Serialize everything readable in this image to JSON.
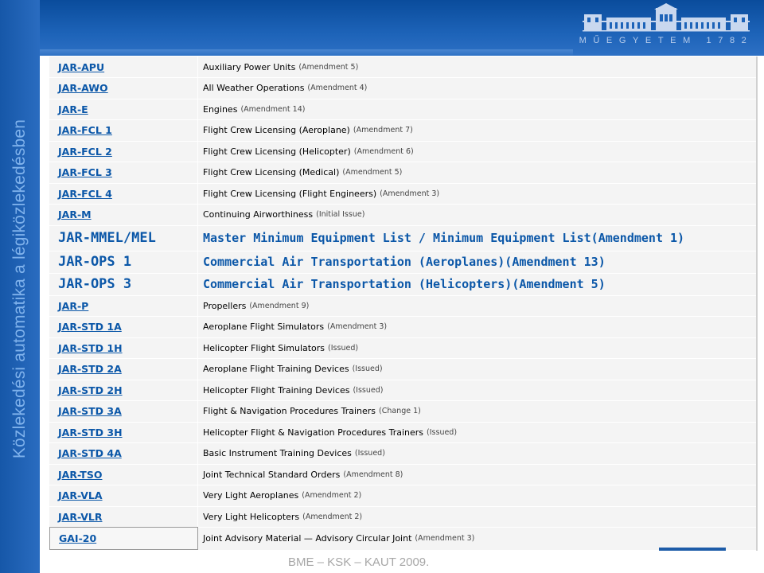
{
  "sidebar_title": "Közlekedési automatika a légiközlekedésben",
  "logo": {
    "text": "MŰEGYETEM 1782"
  },
  "footer": "BME – KSK – KAUT 2009.",
  "colors": {
    "header_blue": "#1d63b8",
    "link_blue": "#0b57a8",
    "table_bg": "#f4f4f4"
  },
  "rows": [
    {
      "code": "JAR-APU",
      "title": "Auxiliary Power Units",
      "amend": "(Amendment 5)",
      "style": "small"
    },
    {
      "code": "JAR-AWO",
      "title": "All Weather Operations",
      "amend": "(Amendment 4)",
      "style": "small"
    },
    {
      "code": "JAR-E",
      "title": "Engines",
      "amend": "(Amendment 14)",
      "style": "small"
    },
    {
      "code": "JAR-FCL 1",
      "title": "Flight Crew Licensing (Aeroplane)",
      "amend": "(Amendment 7)",
      "style": "small"
    },
    {
      "code": "JAR-FCL 2",
      "title": "Flight Crew Licensing (Helicopter)",
      "amend": "(Amendment 6)",
      "style": "small"
    },
    {
      "code": "JAR-FCL 3",
      "title": "Flight Crew Licensing (Medical)",
      "amend": "(Amendment 5)",
      "style": "small"
    },
    {
      "code": "JAR-FCL 4",
      "title": "Flight Crew Licensing (Flight Engineers)",
      "amend": "(Amendment 3)",
      "style": "small"
    },
    {
      "code": "JAR-M",
      "title": "Continuing Airworthiness",
      "amend": "(Initial Issue)",
      "style": "small"
    },
    {
      "code": "JAR-MMEL/MEL",
      "title": "Master Minimum Equipment List / Minimum Equipment List",
      "amend": "(Amendment 1)",
      "style": "big"
    },
    {
      "code": "JAR-OPS 1",
      "title": "Commercial Air Transportation (Aeroplanes)",
      "amend": "(Amendment 13)",
      "style": "big"
    },
    {
      "code": "JAR-OPS 3",
      "title": "Commercial Air Transportation (Helicopters)",
      "amend": "(Amendment 5)",
      "style": "big"
    },
    {
      "code": "JAR-P",
      "title": "Propellers",
      "amend": "(Amendment 9)",
      "style": "small"
    },
    {
      "code": "JAR-STD 1A",
      "title": "Aeroplane Flight Simulators",
      "amend": "(Amendment 3)",
      "style": "small"
    },
    {
      "code": "JAR-STD 1H",
      "title": "Helicopter Flight Simulators",
      "amend": "(Issued)",
      "style": "small"
    },
    {
      "code": "JAR-STD 2A",
      "title": "Aeroplane Flight Training Devices",
      "amend": "(Issued)",
      "style": "small"
    },
    {
      "code": "JAR-STD 2H",
      "title": "Helicopter Flight Training Devices",
      "amend": "(Issued)",
      "style": "small"
    },
    {
      "code": "JAR-STD 3A",
      "title": "Flight & Navigation Procedures Trainers",
      "amend": "(Change 1)",
      "style": "small"
    },
    {
      "code": "JAR-STD 3H",
      "title": "Helicopter Flight & Navigation Procedures Trainers",
      "amend": "(Issued)",
      "style": "small"
    },
    {
      "code": "JAR-STD 4A",
      "title": "Basic Instrument Training Devices",
      "amend": "(Issued)",
      "style": "small"
    },
    {
      "code": "JAR-TSO",
      "title": "Joint Technical Standard Orders",
      "amend": "(Amendment 8)",
      "style": "small"
    },
    {
      "code": "JAR-VLA",
      "title": "Very Light Aeroplanes",
      "amend": "(Amendment 2)",
      "style": "small"
    },
    {
      "code": "JAR-VLR",
      "title": "Very Light Helicopters",
      "amend": "(Amendment 2)",
      "style": "small"
    },
    {
      "code": "GAI-20",
      "title": "Joint Advisory Material — Advisory Circular Joint",
      "amend": "(Amendment 3)",
      "style": "small"
    }
  ]
}
